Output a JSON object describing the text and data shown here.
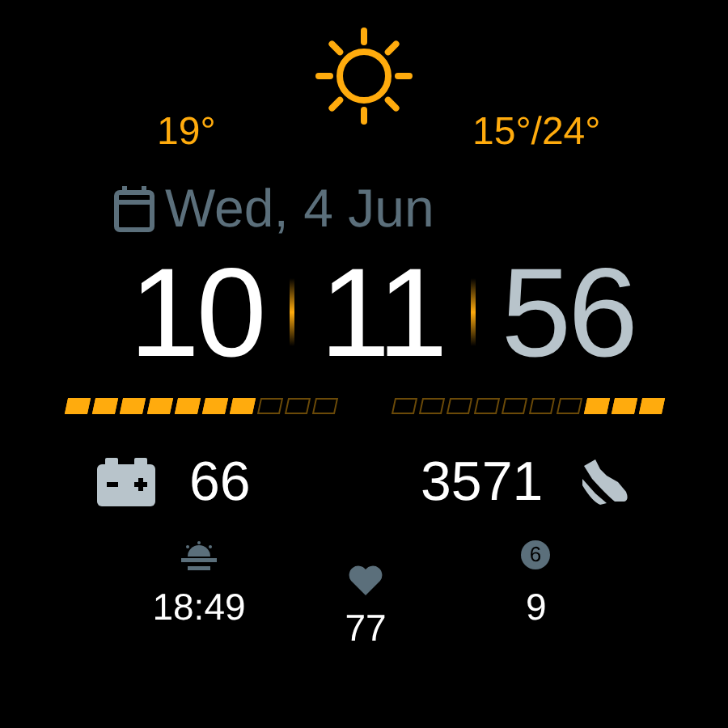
{
  "weather": {
    "current": "19°",
    "range": "15°/24°"
  },
  "date": "Wed, 4 Jun",
  "time": {
    "hours": "10",
    "minutes": "11",
    "seconds": "56"
  },
  "bars": [
    {
      "level": 0.7,
      "reversed": false
    },
    {
      "level": 0.3,
      "reversed": true
    }
  ],
  "battery": "66",
  "steps": "3571",
  "sunset": "18:49",
  "heart_rate": "77",
  "notifications": {
    "badge": "6",
    "value": "9"
  }
}
